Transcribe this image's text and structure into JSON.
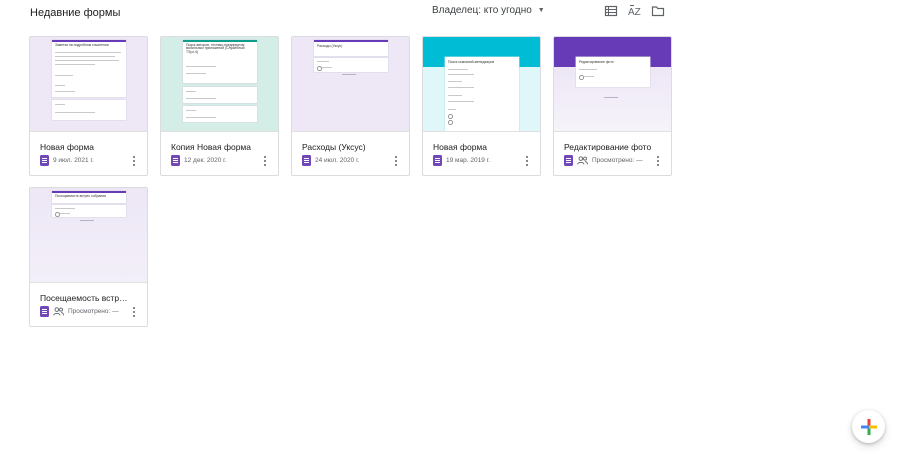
{
  "header": {
    "section_title": "Недавние формы",
    "owner_filter": "Владелец: кто угодно",
    "icons": [
      "list-view-icon",
      "sort-az-icon",
      "folder-icon"
    ],
    "sort_label": "AZ"
  },
  "colors": {
    "forms_purple": "#7248b9",
    "teal": "#00bcd4",
    "deep_purple": "#673ab7"
  },
  "forms": [
    {
      "title": "Новая форма",
      "meta": "9 июл. 2021 г.",
      "shared": false,
      "preview": {
        "heading": "Заметки на подробном сочинении"
      }
    },
    {
      "title": "Копия Новая форма",
      "meta": "12 дек. 2020 г.",
      "shared": false,
      "preview": {
        "heading": "Поиск авторов, технико-предприятия мобильных приложений (Служебный ТЗ(ст.4)"
      }
    },
    {
      "title": "Расходы (Уксус)",
      "meta": "24 июл. 2020 г.",
      "shared": false,
      "preview": {
        "heading": "Расходы (Уксус)"
      }
    },
    {
      "title": "Новая форма",
      "meta": "19 мар. 2019 г.",
      "shared": false,
      "preview": {
        "heading": "Поиск компаний-менеджеров"
      }
    },
    {
      "title": "Редактирование фото",
      "meta": "Просмотрено: —",
      "shared": true,
      "preview": {
        "heading": "Редактирование фото"
      }
    },
    {
      "title": "Посещаемость встреч с...",
      "meta": "Просмотрено: —",
      "shared": true,
      "preview": {
        "heading": "Посещаемость встреч собрания"
      }
    }
  ]
}
